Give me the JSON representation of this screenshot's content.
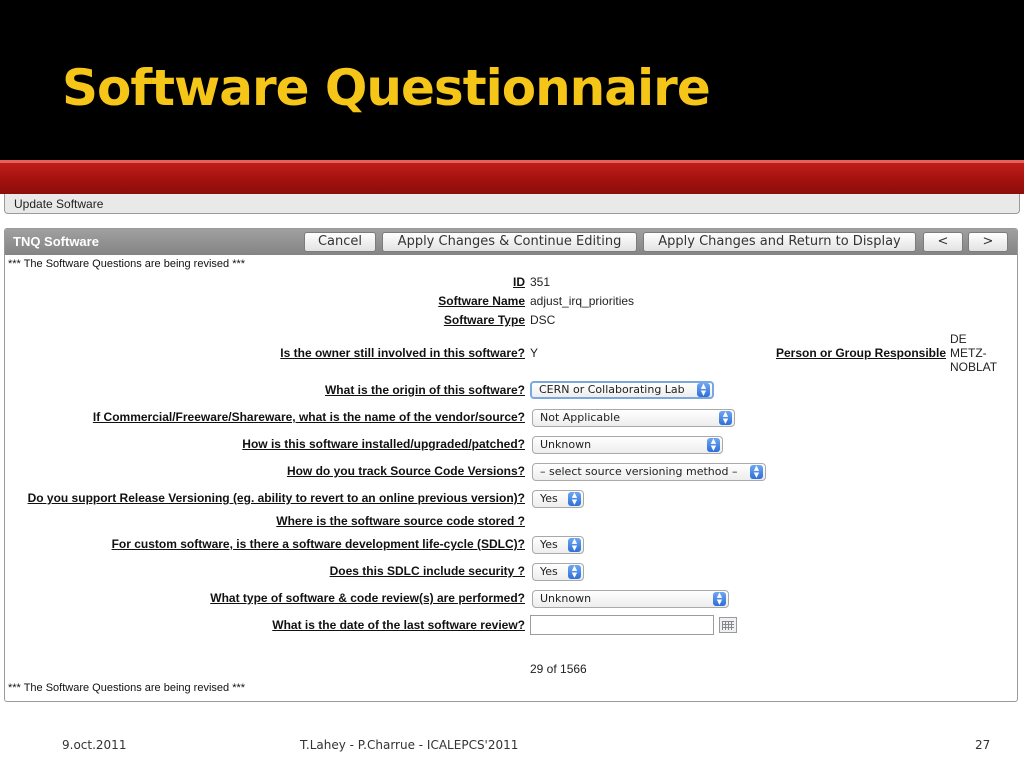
{
  "slide": {
    "title": "Software Questionnaire",
    "footer_left": "9.oct.2011",
    "footer_center": "T.Lahey - P.Charrue - ICALEPCS'2011",
    "page_number": "27"
  },
  "app": {
    "breadcrumb": "Update Software",
    "region_title": "TNQ Software",
    "buttons": {
      "cancel": "Cancel",
      "apply_continue": "Apply Changes & Continue Editing",
      "apply_return": "Apply Changes and Return to Display",
      "prev": "<",
      "next": ">"
    },
    "notice": "*** The Software Questions are being revised ***",
    "record_counter": "29 of 1566"
  },
  "form": {
    "id": {
      "label": "ID",
      "value": "351"
    },
    "software_name": {
      "label": "Software Name",
      "value": "adjust_irq_priorities"
    },
    "software_type": {
      "label": "Software Type",
      "value": "DSC"
    },
    "owner_involved": {
      "label": "Is the owner still involved in this software?",
      "value": "Y"
    },
    "person_responsible": {
      "label": "Person or Group Responsible",
      "value_lines": [
        "DE",
        "METZ-",
        "NOBLAT"
      ]
    },
    "origin": {
      "label": "What is the origin of this software?",
      "value": "CERN or Collaborating Lab"
    },
    "vendor": {
      "label": "If Commercial/Freeware/Shareware, what is the name of the vendor/source?",
      "value": "Not Applicable"
    },
    "installed": {
      "label": "How is this software installed/upgraded/patched?",
      "value": "Unknown"
    },
    "source_versions": {
      "label": "How do you track Source Code Versions?",
      "value": "– select source versioning method –"
    },
    "release_versioning": {
      "label": "Do you support Release Versioning (eg. ability to revert to an online previous version)?",
      "value": "Yes"
    },
    "source_stored": {
      "label": "Where is the software source code stored ?"
    },
    "sdlc": {
      "label": "For custom software, is there a software development life-cycle (SDLC)?",
      "value": "Yes"
    },
    "sdlc_security": {
      "label": "Does this SDLC include security ?",
      "value": "Yes"
    },
    "code_review": {
      "label": "What type of software & code review(s) are performed?",
      "value": "Unknown"
    },
    "last_review": {
      "label": "What is the date of the last software review?",
      "value": ""
    }
  },
  "icons": {
    "select_arrow": "select-arrows-icon",
    "calendar": "calendar-icon"
  },
  "colors": {
    "title": "#f5c518",
    "slide_bg": "#000000",
    "red_band": "#a5120f",
    "region_header": "#8f8f8f",
    "select_arrow": "#3b7ee0"
  }
}
